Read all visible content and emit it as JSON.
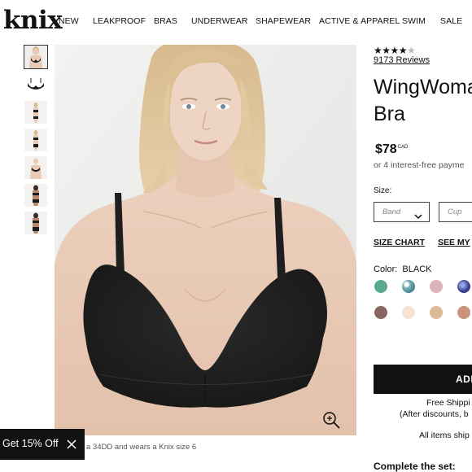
{
  "header": {
    "logo": "knix",
    "nav": [
      "NEW",
      "LEAKPROOF",
      "BRAS",
      "UNDERWEAR",
      "SHAPEWEAR",
      "ACTIVE & APPAREL",
      "SWIM",
      "SALE"
    ]
  },
  "gallery": {
    "thumbnail_count": 7,
    "active_index": 0
  },
  "main_image": {
    "caption": "a 34DD and wears a Knix size 6",
    "zoom_icon": "zoom-in-icon"
  },
  "promo": {
    "label": "Get 15% Off",
    "close_icon": "close-icon"
  },
  "product": {
    "rating_stars": "★★★★",
    "reviews": "9173 Reviews",
    "title_line1": "WingWoma",
    "title_line2": "Bra",
    "price": "$78",
    "currency": "CAD",
    "installments": "or 4 interest-free payme",
    "size_label": "Size:",
    "band_placeholder": "Band",
    "cup_placeholder": "Cup",
    "size_chart": "SIZE CHART",
    "see_my": "SEE MY",
    "color_label": "Color:",
    "color_value": "BLACK",
    "swatches": [
      "#5ba88a",
      "#7fb0b8",
      "#dcb2b6",
      "#3a3f8c",
      "#8a6660",
      "#f5e3d6",
      "#dcb896",
      "#c99479"
    ],
    "add_label": "ADI",
    "shipping_1": "Free Shippi",
    "shipping_2": "(After discounts, b",
    "shipping_3": "All items ship",
    "complete_set": "Complete the set:"
  },
  "colors": {
    "accent": "#111111",
    "image_bg": "#ededec",
    "skin": "#e9cab6",
    "hair": "#d9b98a",
    "bra": "#1c1c1c"
  }
}
